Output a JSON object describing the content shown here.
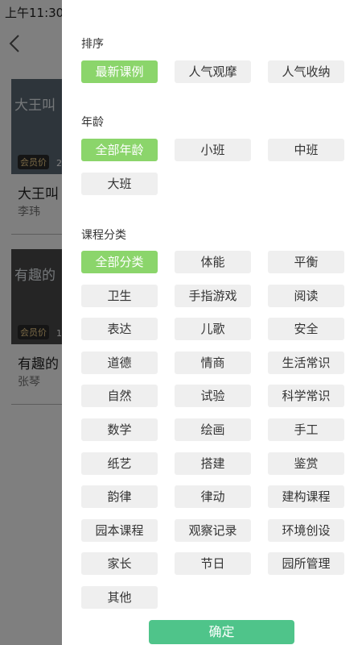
{
  "status_bar": {
    "time": "上午11:30"
  },
  "background": {
    "cards": [
      {
        "thumb_text": "大王叫",
        "badge": "会员价",
        "badge_tail": "2",
        "title": "大王叫",
        "author": "李玮"
      },
      {
        "thumb_text": "有趣的",
        "badge": "会员价",
        "badge_tail": "1",
        "title": "有趣的",
        "author": "张琴"
      }
    ]
  },
  "filter": {
    "sort": {
      "title": "排序",
      "options": [
        "最新课例",
        "人气观摩",
        "人气收纳"
      ],
      "selected": "最新课例"
    },
    "age": {
      "title": "年龄",
      "options": [
        "全部年龄",
        "小班",
        "中班",
        "大班"
      ],
      "selected": "全部年龄"
    },
    "category": {
      "title": "课程分类",
      "options": [
        "全部分类",
        "体能",
        "平衡",
        "卫生",
        "手指游戏",
        "阅读",
        "表达",
        "儿歌",
        "安全",
        "道德",
        "情商",
        "生活常识",
        "自然",
        "试验",
        "科学常识",
        "数学",
        "绘画",
        "手工",
        "纸艺",
        "搭建",
        "鉴赏",
        "韵律",
        "律动",
        "建构课程",
        "园本课程",
        "观察记录",
        "环境创设",
        "家长",
        "节日",
        "园所管理",
        "其他"
      ],
      "selected": "全部分类"
    },
    "confirm_label": "确定"
  },
  "colors": {
    "active_chip": "#8bd56b",
    "chip": "#efefef",
    "confirm": "#4fc48a"
  }
}
